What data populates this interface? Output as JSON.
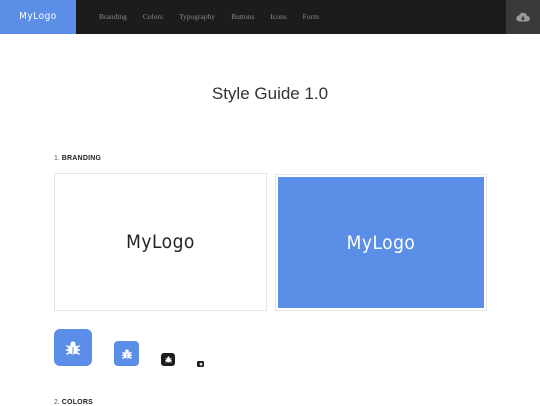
{
  "header": {
    "brand": "MyLogo",
    "nav": [
      "Branding",
      "Colors",
      "Typography",
      "Buttons",
      "Icons",
      "Form"
    ],
    "cloud_icon": "cloud-download-icon"
  },
  "page": {
    "title": "Style Guide 1.0"
  },
  "sections": [
    {
      "number": "1.",
      "title": "BRANDING"
    },
    {
      "number": "2.",
      "title": "COLORS"
    }
  ],
  "branding": {
    "logo_text": "MyLogo",
    "app_icon": "bug-icon"
  },
  "colors_used": {
    "brand_blue": "#5b8ee6",
    "dark": "#1c1c1c"
  }
}
